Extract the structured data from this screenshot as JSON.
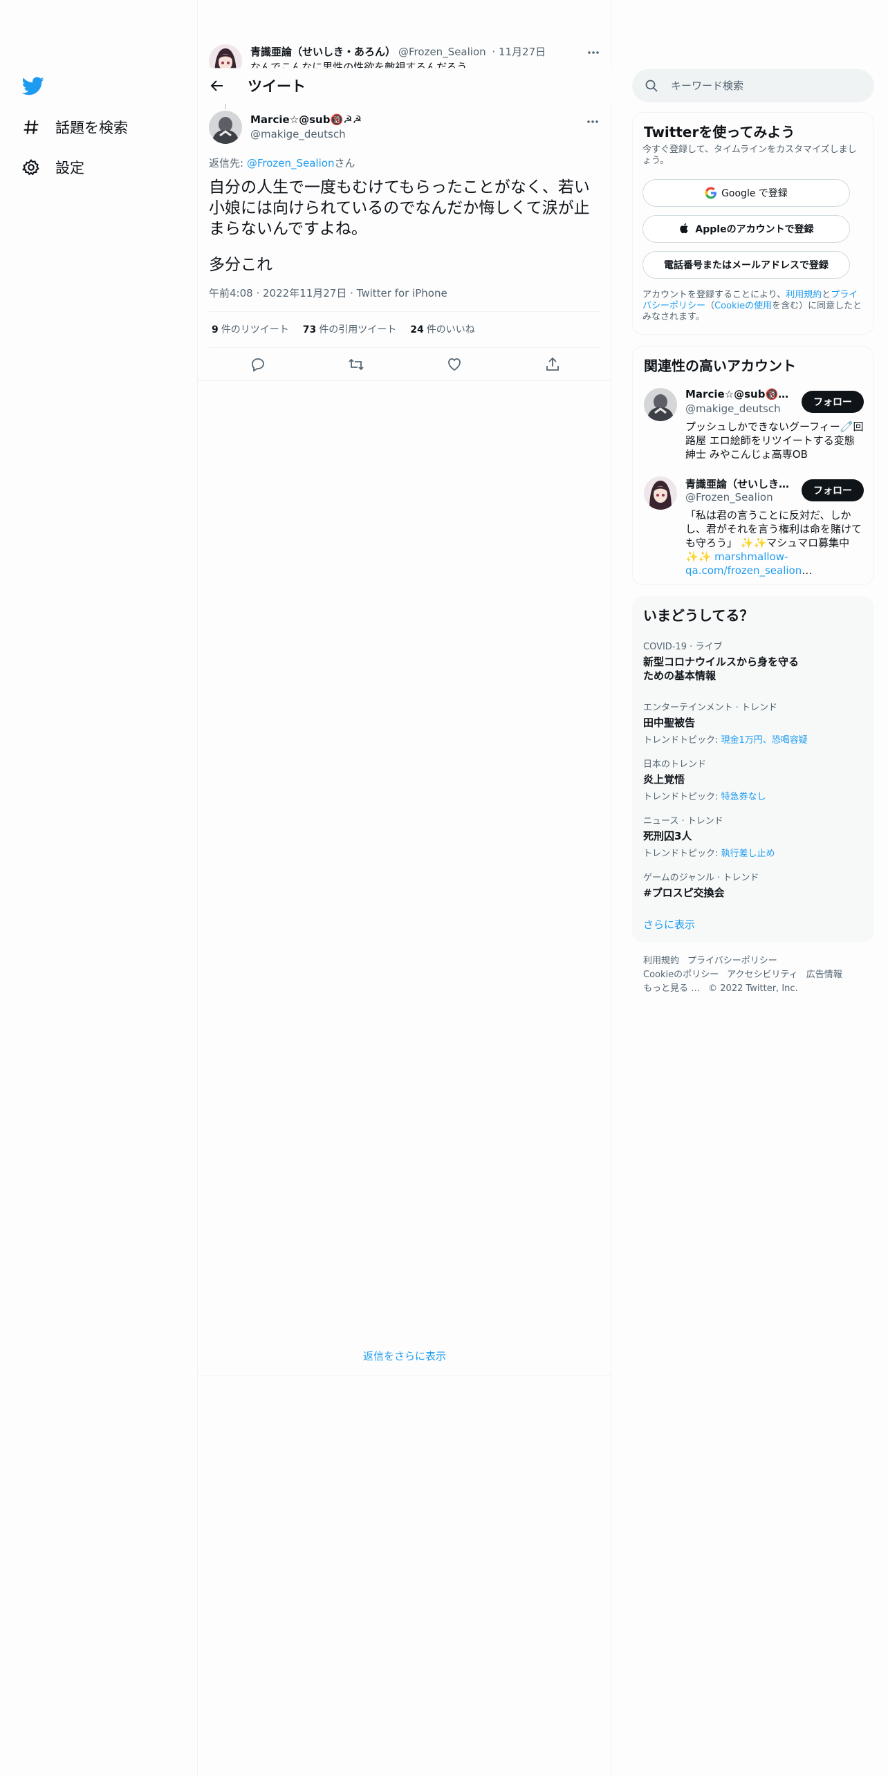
{
  "nav": {
    "explore_label": "話題を検索",
    "settings_label": "設定"
  },
  "header": {
    "title": "ツイート"
  },
  "parent_tweet": {
    "name": "青識亜論（せいしき・あろん）",
    "handle": "@Frozen_Sealion",
    "date": "· 11月27日",
    "text": "なんでこんなに男性の性欲を敵視するんだろう"
  },
  "tweet": {
    "author_name": "Marcie☆@sub🔞☭☭",
    "author_handle": "@makige_deutsch",
    "reply_prefix": "返信先: ",
    "reply_mention": "@Frozen_Sealion",
    "reply_suffix": "さん",
    "text": "自分の人生で一度もむけてもらったことがなく、若い小娘には向けられているのでなんだか悔しくて涙が止まらないんですよね。",
    "text2": "多分これ",
    "timestamp": "午前4:08 · 2022年11月27日 · Twitter for iPhone",
    "retweets_count": "9",
    "retweets_label": "件のリツイート",
    "quotes_count": "73",
    "quotes_label": "件の引用ツイート",
    "likes_count": "24",
    "likes_label": "件のいいね",
    "show_more_replies": "返信をさらに表示"
  },
  "search": {
    "placeholder": "キーワード検索"
  },
  "signup": {
    "title": "Twitterを使ってみよう",
    "subtitle": "今すぐ登録して、タイムラインをカスタマイズしましょう。",
    "google_label": "Google で登録",
    "apple_label": "Appleのアカウントで登録",
    "phone_label": "電話番号またはメールアドレスで登録",
    "terms_prefix": "アカウントを登録することにより、",
    "terms_link": "利用規約",
    "terms_and": "と",
    "privacy_link": "プライバシーポリシー",
    "terms_paren_open": "（",
    "cookie_link": "Cookieの使用",
    "terms_suffix": "を含む）に同意したとみなされます。"
  },
  "related": {
    "title": "関連性の高いアカウント",
    "follow_label": "フォロー",
    "accounts": [
      {
        "name": "Marcie☆@sub🔞☭☭",
        "handle": "@makige_deutsch",
        "bio": "プッシュしかできないグーフィー🧷回路屋 エロ絵師をリツイートする変態紳士 みやこんじょ高専OB"
      },
      {
        "name": "青識亜論（せいしき・あろん）",
        "handle": "@Frozen_Sealion",
        "bio": "「私は君の言うことに反対だ、しかし、君がそれを言う権利は命を賭けても守ろう」 ✨✨マシュマロ募集中✨✨ ",
        "bio_link": "marshmallow-qa.com/frozen_sealion",
        "bio_ellipsis": "…"
      }
    ]
  },
  "trends": {
    "title": "いまどうしてる？",
    "items": [
      {
        "category": "COVID-19 · ライブ",
        "name": "新型コロナウイルスから身を守るための基本情報"
      },
      {
        "category": "エンターテインメント · トレンド",
        "name": "田中聖被告",
        "topics_label": "トレンドトピック: ",
        "topics": "現金1万円、恐喝容疑"
      },
      {
        "category": "日本のトレンド",
        "name": "炎上覚悟",
        "topics_label": "トレンドトピック: ",
        "topics": "特急券なし"
      },
      {
        "category": "ニュース · トレンド",
        "name": "死刑囚3人",
        "topics_label": "トレンドトピック: ",
        "topics": "執行差し止め"
      },
      {
        "category": "ゲームのジャンル · トレンド",
        "name": "#プロスピ交換会"
      }
    ],
    "show_more": "さらに表示"
  },
  "footer": {
    "terms": "利用規約",
    "privacy": "プライバシーポリシー",
    "cookie": "Cookieのポリシー",
    "accessibility": "アクセシビリティ",
    "ads": "広告情報",
    "more": "もっと見る …",
    "copyright": "© 2022 Twitter, Inc."
  },
  "colors": {
    "brand": "#1d9bf0",
    "text": "#0f1419",
    "secondary": "#536471"
  }
}
